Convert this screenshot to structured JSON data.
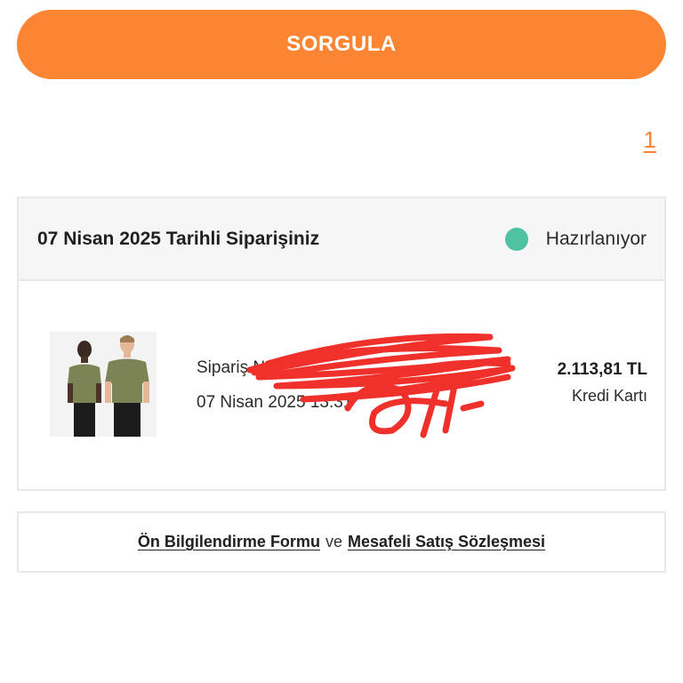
{
  "query_button": {
    "label": "SORGULA"
  },
  "pagination": {
    "current_page": "1"
  },
  "order": {
    "title": "07 Nisan 2025 Tarihli Siparişiniz",
    "status": "Hazırlanıyor",
    "status_color": "#4fc3a1",
    "order_no_label": "Sipariş No:",
    "datetime": "07 Nisan 2025 13:31",
    "amount": "2.113,81 TL",
    "payment_method": "Kredi Kartı",
    "product_image": "two models wearing olive green t-shirts and black pants"
  },
  "legal": {
    "pre_info_link": "Ön Bilgilendirme Formu",
    "separator": "ve",
    "contract_link": "Mesafeli Satış Sözleşmesi"
  },
  "colors": {
    "accent": "#fb8533",
    "border": "#e8e8e8",
    "header_bg": "#f6f6f6"
  }
}
